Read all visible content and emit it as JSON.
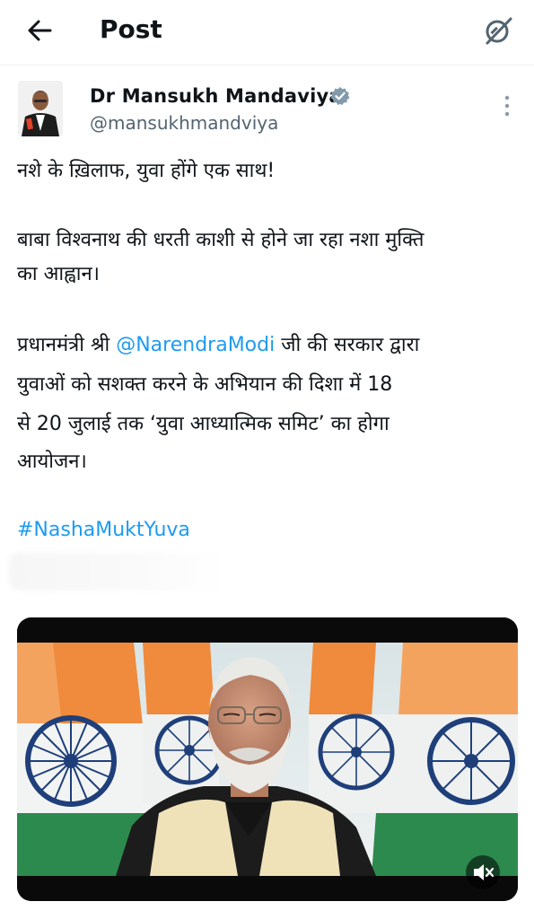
{
  "header": {
    "title": "Post",
    "back_icon": "arrow-left-icon",
    "grok_icon": "grok-icon"
  },
  "author": {
    "name": "Dr Mansukh Mandaviya",
    "handle": "@mansukhmandviya",
    "verified": true
  },
  "post": {
    "line1": "नशे के ख़िलाफ, युवा होंगे एक साथ!",
    "para2_line1": "बाबा विश्वनाथ की धरती काशी से होने जा रहा नशा मुक्ति",
    "para2_line2": "का आह्वान।",
    "para3_pre": "प्रधानमंत्री श्री ",
    "mention": "@NarendraModi",
    "para3_post": " जी की सरकार द्वारा",
    "para3_line2": "युवाओं को सशक्त करने के अभियान की दिशा में 18",
    "para3_line3": "से 20 जुलाई तक ‘युवा आध्यात्मिक समिट’ का होगा",
    "para3_line4": "आयोजन।",
    "hashtag": "#NashaMuktYuva"
  },
  "media": {
    "type": "video",
    "mute_icon": "speaker-muted-icon"
  },
  "colors": {
    "link": "#1d9bf0",
    "text": "#0f1419",
    "secondary": "#536471",
    "saffron": "#f08a3c",
    "green": "#1f8a4a",
    "chakra": "#1f3f7a"
  }
}
